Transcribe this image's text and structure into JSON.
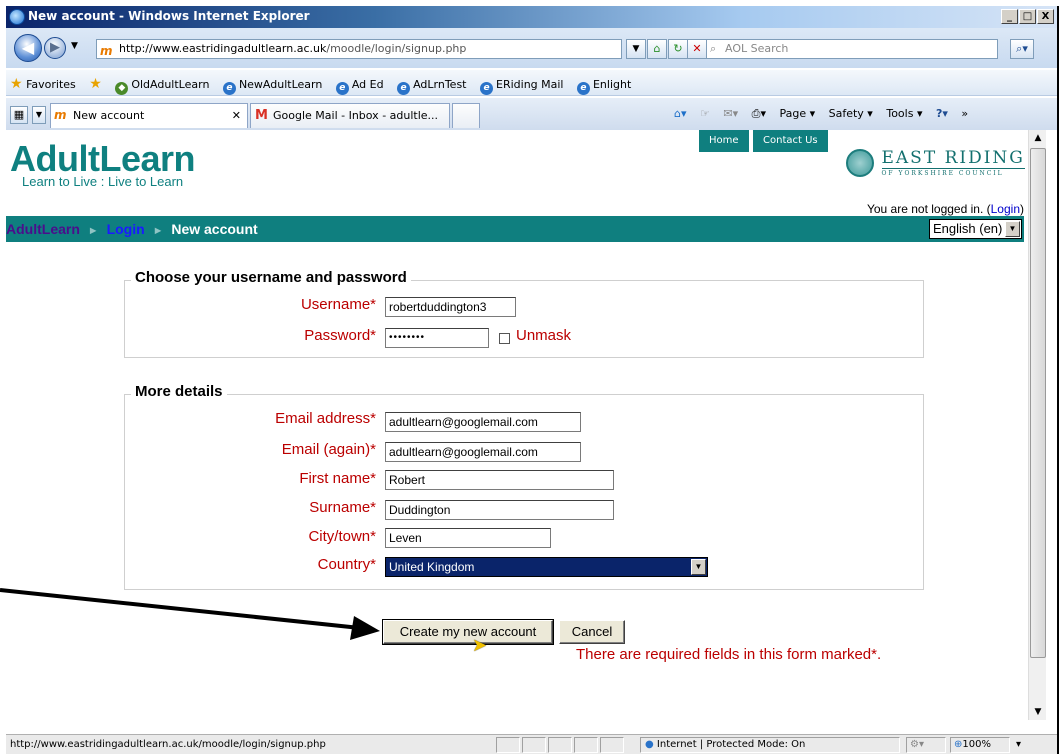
{
  "window": {
    "title": "New account - Windows Internet Explorer",
    "min": "_",
    "max": "□",
    "close": "X"
  },
  "browser": {
    "url_host": "http://www.eastridingadultlearn.ac.uk",
    "url_path": "/moodle/login/signup.php",
    "search_placeholder": "AOL Search"
  },
  "favorites": {
    "label": "Favorites",
    "items": [
      "OldAdultLearn",
      "NewAdultLearn",
      "Ad Ed",
      "AdLrnTest",
      "ERiding Mail",
      "Enlight"
    ]
  },
  "tabs": [
    {
      "label": "New account",
      "active": true
    },
    {
      "label": "Google Mail - Inbox - adultle..."
    }
  ],
  "command_bar": {
    "page": "Page ▾",
    "safety": "Safety ▾",
    "tools": "Tools ▾"
  },
  "site": {
    "logo": "AdultLearn",
    "tagline": "Learn to Live : Live to Learn",
    "top_links": [
      "Home",
      "Contact Us"
    ],
    "council_name": "EAST RIDING",
    "council_sub": "OF YORKSHIRE COUNCIL",
    "login_status": "You are not logged in. (",
    "login_link": "Login",
    "login_close": ")"
  },
  "breadcrumb": {
    "items": [
      "AdultLearn",
      "Login",
      "New account"
    ],
    "sep": "►"
  },
  "language": "English (en)",
  "form": {
    "section1": "Choose your username and password",
    "username_label": "Username*",
    "username_value": "robertduddington3",
    "password_label": "Password*",
    "password_value": "••••••••",
    "unmask_label": "Unmask",
    "section2": "More details",
    "email_label": "Email address*",
    "email_value": "adultlearn@googlemail.com",
    "email2_label": "Email (again)*",
    "email2_value": "adultlearn@googlemail.com",
    "firstname_label": "First name*",
    "firstname_value": "Robert",
    "surname_label": "Surname*",
    "surname_value": "Duddington",
    "city_label": "City/town*",
    "city_value": "Leven",
    "country_label": "Country*",
    "country_value": "United Kingdom",
    "submit_label": "Create my new account",
    "cancel_label": "Cancel",
    "required_note": "There are required fields in this form marked*."
  },
  "status": {
    "url": "http://www.eastridingadultlearn.ac.uk/moodle/login/signup.php",
    "zone": "Internet | Protected Mode: On",
    "zoom": "100%"
  },
  "colors": {
    "brand_teal": "#0f7f7f",
    "required_red": "#bb0000",
    "title_blue": "#0a246a"
  }
}
